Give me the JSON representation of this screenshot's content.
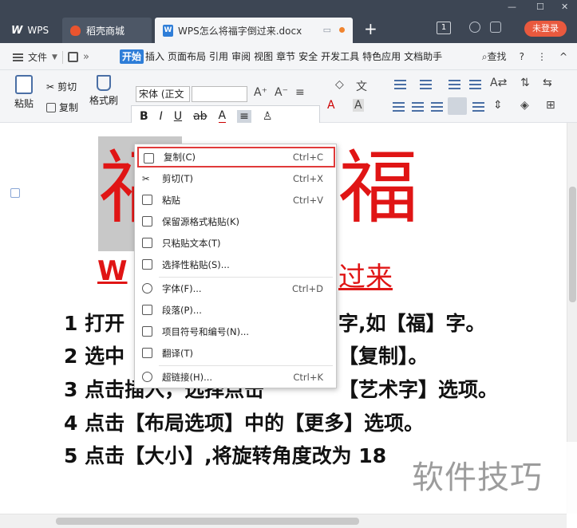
{
  "tabbar": {
    "home_tab": "WPS",
    "store_tab": "稻壳商城",
    "doc_tab": "WPS怎么将福字倒过来.docx",
    "page_count": "1",
    "login_button": "未登录",
    "add_tab": "+"
  },
  "menubar": {
    "file_label": "文件",
    "tabs": [
      "开始",
      "插入",
      "页面布局",
      "引用",
      "审阅",
      "视图",
      "章节",
      "安全",
      "开发工具",
      "特色应用",
      "文档助手"
    ],
    "search_label": "查找",
    "help_label": "?",
    "more_label": "⋮",
    "collapse_label": "^"
  },
  "ribbon": {
    "paste_label": "粘贴",
    "cut_label": "剪切",
    "copy_label": "复制",
    "format_painter_label": "格式刷",
    "font_name": "宋体 (正文"
  },
  "context_menu": {
    "items": [
      {
        "label": "复制(C)",
        "shortcut": "Ctrl+C"
      },
      {
        "label": "剪切(T)",
        "shortcut": "Ctrl+X"
      },
      {
        "label": "粘贴",
        "shortcut": "Ctrl+V"
      },
      {
        "label": "保留源格式粘贴(K)",
        "shortcut": ""
      },
      {
        "label": "只粘贴文本(T)",
        "shortcut": ""
      },
      {
        "label": "选择性粘贴(S)...",
        "shortcut": ""
      },
      {
        "label": "字体(F)...",
        "shortcut": "Ctrl+D"
      },
      {
        "label": "段落(P)...",
        "shortcut": ""
      },
      {
        "label": "项目符号和编号(N)...",
        "shortcut": ""
      },
      {
        "label": "翻译(T)",
        "shortcut": ""
      },
      {
        "label": "超链接(H)...",
        "shortcut": "Ctrl+K"
      }
    ]
  },
  "document": {
    "fu_left": "福",
    "fu_right": "福",
    "heading_left": "W",
    "heading_right": "过来",
    "steps": [
      {
        "head": "1 打开",
        "tail": "字,如【福】字。"
      },
      {
        "head": "2 选中",
        "tail": "【复制】。"
      },
      {
        "head": "3 点击插入，选择点击",
        "tail": "【艺术字】选项。"
      },
      {
        "head": "4 点击【布局选项】中的【更多】选项。",
        "tail": ""
      },
      {
        "head": "5 点击【大小】,将旋转角度改为 18",
        "tail": ""
      }
    ]
  },
  "watermark": "软件技巧",
  "colors": {
    "tabbar_bg": "#3d4654",
    "accent_blue": "#2f7ed8",
    "fu_red": "#e01515",
    "login_red": "#e9593e",
    "highlight_red": "#e03a3a"
  }
}
